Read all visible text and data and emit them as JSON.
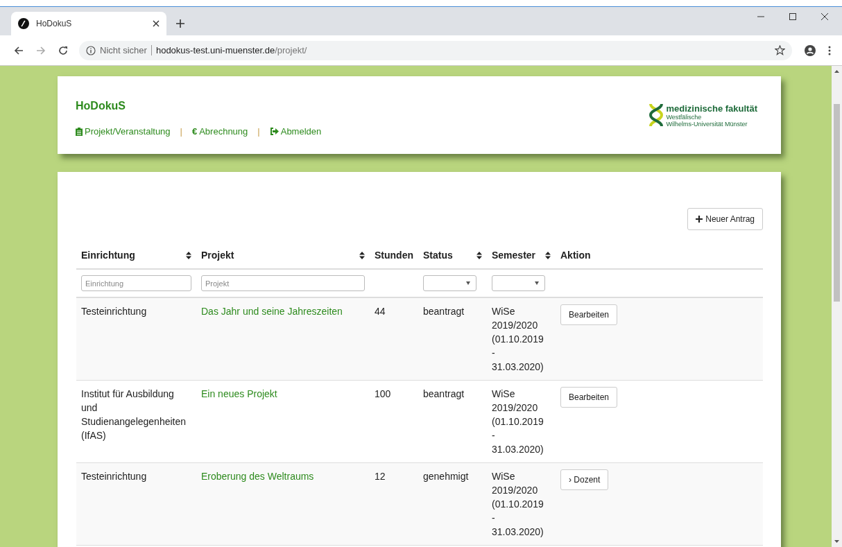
{
  "browser": {
    "tab_title": "HoDokuS",
    "security": "Nicht sicher",
    "url_host": "hodokus-test.uni-muenster.de",
    "url_path": "/projekt/"
  },
  "header": {
    "brand": "HoDokuS",
    "separator": "|",
    "nav": [
      {
        "kind": "clipboard",
        "label": "Projekt/Veranstaltung"
      },
      {
        "kind": "currency",
        "symbol": "€",
        "label": "Abrechnung"
      },
      {
        "kind": "logout",
        "label": "Abmelden"
      }
    ],
    "logo": {
      "title": "medizinische fakultät",
      "line_1": "Westfälische",
      "line_2": "Wilhelms-Universität Münster"
    }
  },
  "new_button": {
    "label": "Neuer Antrag"
  },
  "table": {
    "columns": [
      {
        "label": "Einrichtung",
        "sortable": true
      },
      {
        "label": "Projekt",
        "sortable": true
      },
      {
        "label": "Stunden",
        "sortable": false
      },
      {
        "label": "Status",
        "sortable": true
      },
      {
        "label": "Semester",
        "sortable": true
      },
      {
        "label": "Aktion",
        "sortable": false
      }
    ],
    "filters": [
      {
        "kind": "text",
        "placeholder": "Einrichtung"
      },
      {
        "kind": "text",
        "placeholder": "Projekt"
      },
      {
        "kind": "none"
      },
      {
        "kind": "select"
      },
      {
        "kind": "select"
      },
      {
        "kind": "none"
      }
    ],
    "rows": [
      {
        "einrichtung": "Testeinrichtung",
        "projekt": "Das Jahr und seine Jahreszeiten",
        "stunden": "44",
        "status": "beantragt",
        "semester": "WiSe 2019/2020 (01.10.2019 - 31.03.2020)",
        "action": {
          "kind": "edit",
          "label": "Bearbeiten"
        }
      },
      {
        "einrichtung": "Institut für Ausbildung und Studienangelegenheiten (IfAS)",
        "projekt": "Ein neues Projekt",
        "stunden": "100",
        "status": "beantragt",
        "semester": "WiSe 2019/2020 (01.10.2019 - 31.03.2020)",
        "action": {
          "kind": "edit",
          "label": "Bearbeiten"
        }
      },
      {
        "einrichtung": "Testeinrichtung",
        "projekt": "Eroberung des Weltraums",
        "stunden": "12",
        "status": "genehmigt",
        "semester": "WiSe 2019/2020 (01.10.2019 - 31.03.2020)",
        "action": {
          "kind": "chevron",
          "prefix": "›",
          "label": "Dozent"
        }
      }
    ]
  }
}
